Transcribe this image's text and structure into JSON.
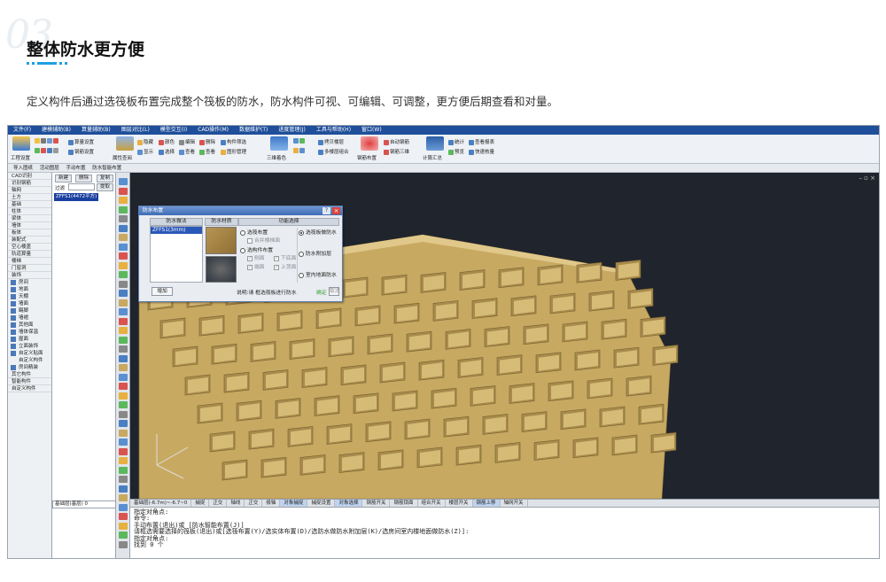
{
  "header": {
    "section_number": "03",
    "title": "整体防水更方便",
    "description": "定义构件后通过选筏板布置完成整个筏板的防水，防水构件可视、可编辑、可调整，更方便后期查看和对量。"
  },
  "menubar": [
    "文件(F)",
    "建模辅助(B)",
    "算量辅助(B)",
    "图层对比(L)",
    "模型交互(I)",
    "CAD操作(M)",
    "数据维护(T)",
    "进度管理(J)",
    "工具与帮助(H)",
    "窗口(W)"
  ],
  "ribbon": {
    "groups": [
      "工程设置",
      "属性查阅",
      "隐藏",
      "显示",
      "颜色",
      "选择",
      "编辑",
      "查看",
      "删除",
      "查看",
      "构件筛选",
      "图形管理",
      "三维着色",
      "拷贝楼层",
      "多楼层组合",
      "钢筋布置",
      "自动钢筋",
      "钢筋三维",
      "计算汇总",
      "统计",
      "预览",
      "查看报表",
      "快速核量"
    ],
    "buttons": [
      "算量设置",
      "钢筋设置"
    ]
  },
  "toolbar2": [
    "导入图纸",
    "活动图层",
    "手动布置",
    "防水智能布置"
  ],
  "left_tree": {
    "items": [
      "CAD识别",
      "识别钢筋",
      "轴网",
      "土方",
      "基础",
      "柱体",
      "梁体",
      "墙体",
      "板体",
      "装配式",
      "空心楼盖",
      "轨道算量",
      "楼梯",
      "门窗洞",
      "装饰"
    ],
    "subitems": [
      "房间",
      "地面",
      "天棚",
      "墙面",
      "踢脚",
      "墙裙",
      "其他面",
      "墙体保温",
      "屋面",
      "立面装饰",
      "自定义贴面",
      "自定义构件",
      "房间精装"
    ],
    "tail_items": [
      "其它构件",
      "智能构件",
      "自定义构件"
    ]
  },
  "mid_panel": {
    "new_button": "新建",
    "delete_button": "删除",
    "copy_button": "复制",
    "filter_label": "过滤",
    "pick_button": "提取",
    "selected_item": "ZFFS1(4472平方)"
  },
  "dialog": {
    "title": "防水布置",
    "col_methods": "防水做法",
    "col_material": "防水材质",
    "col_function": "功能选择",
    "method_item": "ZFFS1(3mm)",
    "options": {
      "raft": "选筏布置",
      "merge": "合并楼梯面",
      "component": "选构件布置",
      "side": "侧面",
      "bottom": "下底面",
      "top_end": "端面",
      "top": "上顶面",
      "raft_waterproof": "选筏板做防水",
      "add_layer": "防水附加层",
      "indoor": "室内地面防水"
    },
    "add_button": "增加",
    "hint": "说明:请 框选筏板进行防水",
    "ok_button": "确定",
    "cancel_button": "取消"
  },
  "viewport": {
    "controls": "–  ▫  ×"
  },
  "status_bar": {
    "coordinate": "基础层(-6.7m)~-6.7~0",
    "items": [
      "捕捉",
      "正交",
      "轴线",
      "正交",
      "极轴",
      "对象捕捉",
      "捕捉设置",
      "对象选择",
      "钢筋开关",
      "钢筋锁面",
      "组合开关",
      "楼层开关",
      "钢筋上移",
      "轴网开关"
    ],
    "active": [
      "对象捕捉",
      "对象选择",
      "钢筋上移"
    ]
  },
  "floor_selector": "基础层(基层)   0",
  "command_lines": [
    "指定对角点:",
    "命令:",
    "手动布置(退出)或 [防水智能布置(J)]",
    "请框选需要选择的筏板(退出)或[选筏布置(Y)/选实体布置(D)/选防水做防水附加层(K)/选房间室内楼地面做防水(Z)]:",
    "指定对角点:",
    "找到 0 个"
  ],
  "colors": {
    "accent": "#1ea0e0",
    "menubar": "#1f4f9a",
    "raft": "#c8a961",
    "viewport_bg": "#20242c"
  }
}
